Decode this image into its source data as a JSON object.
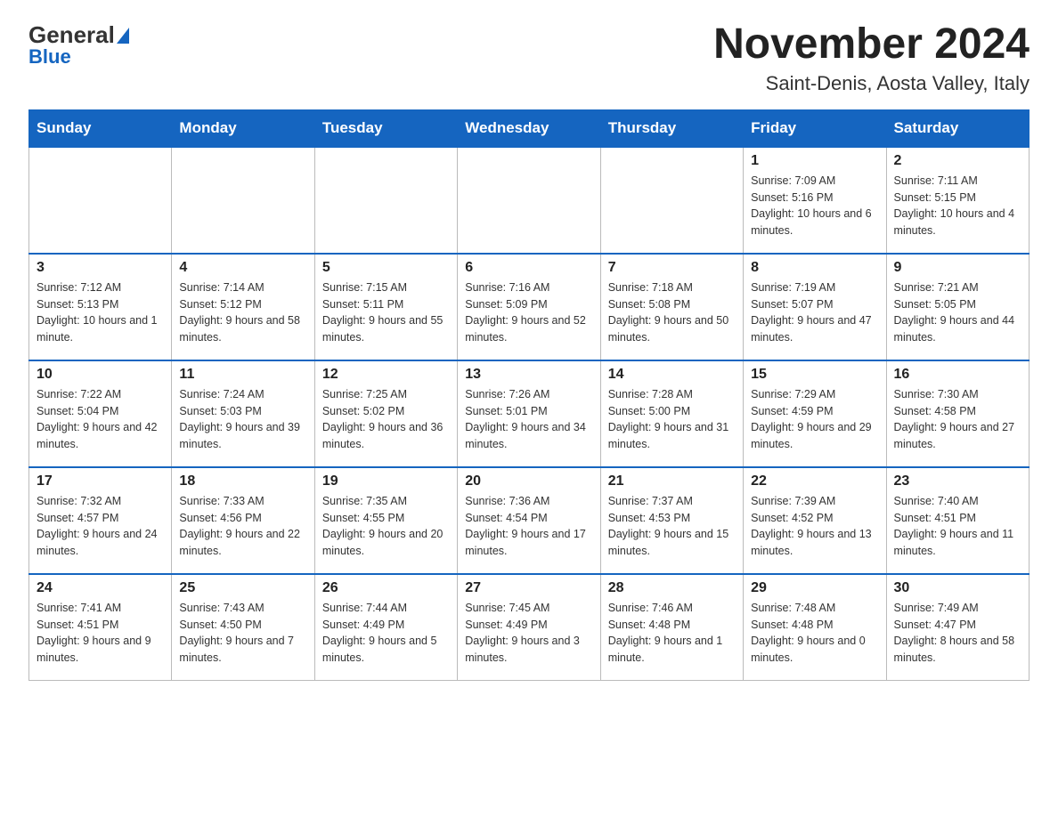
{
  "header": {
    "logo_general": "General",
    "logo_blue": "Blue",
    "month_title": "November 2024",
    "location": "Saint-Denis, Aosta Valley, Italy"
  },
  "days_of_week": [
    "Sunday",
    "Monday",
    "Tuesday",
    "Wednesday",
    "Thursday",
    "Friday",
    "Saturday"
  ],
  "weeks": [
    [
      {
        "day": "",
        "sunrise": "",
        "sunset": "",
        "daylight": ""
      },
      {
        "day": "",
        "sunrise": "",
        "sunset": "",
        "daylight": ""
      },
      {
        "day": "",
        "sunrise": "",
        "sunset": "",
        "daylight": ""
      },
      {
        "day": "",
        "sunrise": "",
        "sunset": "",
        "daylight": ""
      },
      {
        "day": "",
        "sunrise": "",
        "sunset": "",
        "daylight": ""
      },
      {
        "day": "1",
        "sunrise": "Sunrise: 7:09 AM",
        "sunset": "Sunset: 5:16 PM",
        "daylight": "Daylight: 10 hours and 6 minutes."
      },
      {
        "day": "2",
        "sunrise": "Sunrise: 7:11 AM",
        "sunset": "Sunset: 5:15 PM",
        "daylight": "Daylight: 10 hours and 4 minutes."
      }
    ],
    [
      {
        "day": "3",
        "sunrise": "Sunrise: 7:12 AM",
        "sunset": "Sunset: 5:13 PM",
        "daylight": "Daylight: 10 hours and 1 minute."
      },
      {
        "day": "4",
        "sunrise": "Sunrise: 7:14 AM",
        "sunset": "Sunset: 5:12 PM",
        "daylight": "Daylight: 9 hours and 58 minutes."
      },
      {
        "day": "5",
        "sunrise": "Sunrise: 7:15 AM",
        "sunset": "Sunset: 5:11 PM",
        "daylight": "Daylight: 9 hours and 55 minutes."
      },
      {
        "day": "6",
        "sunrise": "Sunrise: 7:16 AM",
        "sunset": "Sunset: 5:09 PM",
        "daylight": "Daylight: 9 hours and 52 minutes."
      },
      {
        "day": "7",
        "sunrise": "Sunrise: 7:18 AM",
        "sunset": "Sunset: 5:08 PM",
        "daylight": "Daylight: 9 hours and 50 minutes."
      },
      {
        "day": "8",
        "sunrise": "Sunrise: 7:19 AM",
        "sunset": "Sunset: 5:07 PM",
        "daylight": "Daylight: 9 hours and 47 minutes."
      },
      {
        "day": "9",
        "sunrise": "Sunrise: 7:21 AM",
        "sunset": "Sunset: 5:05 PM",
        "daylight": "Daylight: 9 hours and 44 minutes."
      }
    ],
    [
      {
        "day": "10",
        "sunrise": "Sunrise: 7:22 AM",
        "sunset": "Sunset: 5:04 PM",
        "daylight": "Daylight: 9 hours and 42 minutes."
      },
      {
        "day": "11",
        "sunrise": "Sunrise: 7:24 AM",
        "sunset": "Sunset: 5:03 PM",
        "daylight": "Daylight: 9 hours and 39 minutes."
      },
      {
        "day": "12",
        "sunrise": "Sunrise: 7:25 AM",
        "sunset": "Sunset: 5:02 PM",
        "daylight": "Daylight: 9 hours and 36 minutes."
      },
      {
        "day": "13",
        "sunrise": "Sunrise: 7:26 AM",
        "sunset": "Sunset: 5:01 PM",
        "daylight": "Daylight: 9 hours and 34 minutes."
      },
      {
        "day": "14",
        "sunrise": "Sunrise: 7:28 AM",
        "sunset": "Sunset: 5:00 PM",
        "daylight": "Daylight: 9 hours and 31 minutes."
      },
      {
        "day": "15",
        "sunrise": "Sunrise: 7:29 AM",
        "sunset": "Sunset: 4:59 PM",
        "daylight": "Daylight: 9 hours and 29 minutes."
      },
      {
        "day": "16",
        "sunrise": "Sunrise: 7:30 AM",
        "sunset": "Sunset: 4:58 PM",
        "daylight": "Daylight: 9 hours and 27 minutes."
      }
    ],
    [
      {
        "day": "17",
        "sunrise": "Sunrise: 7:32 AM",
        "sunset": "Sunset: 4:57 PM",
        "daylight": "Daylight: 9 hours and 24 minutes."
      },
      {
        "day": "18",
        "sunrise": "Sunrise: 7:33 AM",
        "sunset": "Sunset: 4:56 PM",
        "daylight": "Daylight: 9 hours and 22 minutes."
      },
      {
        "day": "19",
        "sunrise": "Sunrise: 7:35 AM",
        "sunset": "Sunset: 4:55 PM",
        "daylight": "Daylight: 9 hours and 20 minutes."
      },
      {
        "day": "20",
        "sunrise": "Sunrise: 7:36 AM",
        "sunset": "Sunset: 4:54 PM",
        "daylight": "Daylight: 9 hours and 17 minutes."
      },
      {
        "day": "21",
        "sunrise": "Sunrise: 7:37 AM",
        "sunset": "Sunset: 4:53 PM",
        "daylight": "Daylight: 9 hours and 15 minutes."
      },
      {
        "day": "22",
        "sunrise": "Sunrise: 7:39 AM",
        "sunset": "Sunset: 4:52 PM",
        "daylight": "Daylight: 9 hours and 13 minutes."
      },
      {
        "day": "23",
        "sunrise": "Sunrise: 7:40 AM",
        "sunset": "Sunset: 4:51 PM",
        "daylight": "Daylight: 9 hours and 11 minutes."
      }
    ],
    [
      {
        "day": "24",
        "sunrise": "Sunrise: 7:41 AM",
        "sunset": "Sunset: 4:51 PM",
        "daylight": "Daylight: 9 hours and 9 minutes."
      },
      {
        "day": "25",
        "sunrise": "Sunrise: 7:43 AM",
        "sunset": "Sunset: 4:50 PM",
        "daylight": "Daylight: 9 hours and 7 minutes."
      },
      {
        "day": "26",
        "sunrise": "Sunrise: 7:44 AM",
        "sunset": "Sunset: 4:49 PM",
        "daylight": "Daylight: 9 hours and 5 minutes."
      },
      {
        "day": "27",
        "sunrise": "Sunrise: 7:45 AM",
        "sunset": "Sunset: 4:49 PM",
        "daylight": "Daylight: 9 hours and 3 minutes."
      },
      {
        "day": "28",
        "sunrise": "Sunrise: 7:46 AM",
        "sunset": "Sunset: 4:48 PM",
        "daylight": "Daylight: 9 hours and 1 minute."
      },
      {
        "day": "29",
        "sunrise": "Sunrise: 7:48 AM",
        "sunset": "Sunset: 4:48 PM",
        "daylight": "Daylight: 9 hours and 0 minutes."
      },
      {
        "day": "30",
        "sunrise": "Sunrise: 7:49 AM",
        "sunset": "Sunset: 4:47 PM",
        "daylight": "Daylight: 8 hours and 58 minutes."
      }
    ]
  ]
}
